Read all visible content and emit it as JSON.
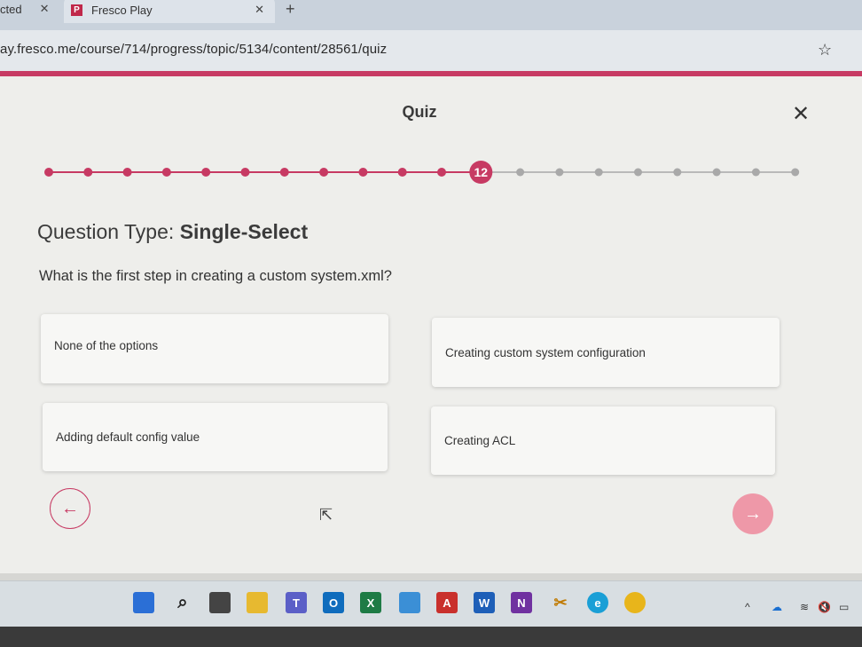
{
  "browser": {
    "prev_tab_title": "cted",
    "prev_tab_close": "✕",
    "active_tab_title": "Fresco Play",
    "active_tab_favicon": "P",
    "active_tab_close": "✕",
    "new_tab": "+",
    "url": "ay.fresco.me/course/714/progress/topic/5134/content/28561/quiz",
    "bookmark_icon": "star-icon"
  },
  "quiz": {
    "title": "Quiz",
    "close": "✕",
    "current_step": "12",
    "completed_steps": 11,
    "remaining_steps": 8,
    "question_type_label": "Question Type: ",
    "question_type_value": "Single-Select",
    "question": "What is the first step in creating a custom system.xml?",
    "options": [
      {
        "label": "None of the options"
      },
      {
        "label": "Creating custom system configuration"
      },
      {
        "label": "Adding default config value"
      },
      {
        "label": "Creating ACL"
      }
    ],
    "prev_arrow": "←",
    "next_arrow": "→"
  },
  "colors": {
    "accent": "#c73a63",
    "next_button": "#ee98a8"
  },
  "taskbar": {
    "icons": [
      "windows-start-icon",
      "search-icon",
      "task-view-icon",
      "file-explorer-icon",
      "teams-icon",
      "outlook-icon",
      "excel-icon",
      "notepad-icon",
      "acrobat-icon",
      "word-icon",
      "onenote-icon",
      "snipping-tool-icon",
      "edge-icon",
      "chrome-icon"
    ],
    "tray": {
      "chevron": "^",
      "volume": "🔇"
    }
  }
}
